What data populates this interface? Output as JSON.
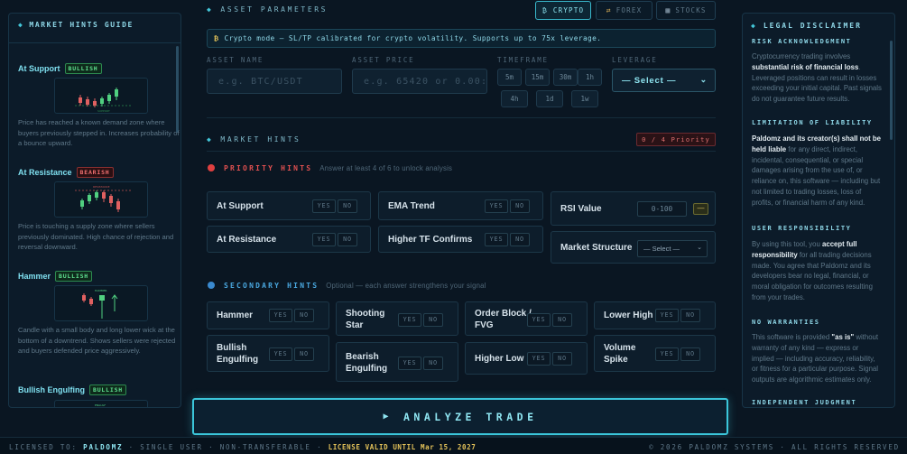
{
  "left": {
    "title": "MARKET HINTS GUIDE",
    "items": [
      {
        "title": "At Support",
        "badge": "BULLISH",
        "desc": "Price has reached a known demand zone where buyers previously stepped in. Increases probability of a bounce upward."
      },
      {
        "title": "At Resistance",
        "badge": "BEARISH",
        "desc": "Price is touching a supply zone where sellers previously dominated. High chance of rejection and reversal downward."
      },
      {
        "title": "Hammer",
        "badge": "BULLISH",
        "desc": "Candle with a small body and long lower wick at the bottom of a downtrend. Shows sellers were rejected and buyers defended price aggressively."
      },
      {
        "title": "Bullish Engulfing",
        "badge": "BULLISH",
        "desc": ""
      }
    ]
  },
  "asset": {
    "title": "ASSET PARAMETERS",
    "tabs": {
      "crypto": "₿ CRYPTO",
      "forex": "FOREX",
      "stocks": "STOCKS"
    },
    "info": "Crypto mode — SL/TP calibrated for crypto volatility. Supports up to 75x leverage.",
    "info_icon": "₿",
    "name_label": "ASSET NAME",
    "name_placeholder": "e.g. BTC/USDT",
    "price_label": "ASSET PRICE",
    "price_placeholder": "e.g. 65420 or 0.00:",
    "timeframe_label": "TIMEFRAME",
    "timeframes": [
      "5m",
      "15m",
      "30m",
      "1h",
      "4h",
      "1d",
      "1w"
    ],
    "leverage_label": "LEVERAGE",
    "leverage_value": "— Select —"
  },
  "hints": {
    "title": "MARKET HINTS",
    "priority_count": "0 / 4 Priority",
    "priority_title": "PRIORITY HINTS",
    "priority_sub": "Answer at least 4 of 6 to unlock analysis",
    "priority_cards": [
      {
        "label": "At Support"
      },
      {
        "label": "EMA Trend"
      },
      {
        "label": "At Resistance"
      },
      {
        "label": "Higher TF Confirms"
      }
    ],
    "rsi_label": "RSI Value",
    "rsi_placeholder": "0-100",
    "rsi_dash": "—",
    "ms_label": "Market Structure",
    "ms_value": "— Select —",
    "secondary_title": "SECONDARY HINTS",
    "secondary_sub": "Optional — each answer strengthens your signal",
    "secondary_cards": [
      {
        "label": "Hammer"
      },
      {
        "label": "Shooting Star"
      },
      {
        "label": "Order Block / FVG"
      },
      {
        "label": "Lower High"
      },
      {
        "label": "Bullish Engulfing"
      },
      {
        "label": "Bearish Engulfing"
      },
      {
        "label": "Higher Low"
      },
      {
        "label": "Volume Spike"
      }
    ],
    "yes": "YES",
    "no": "NO"
  },
  "analyze_label": "ANALYZE TRADE",
  "right": {
    "title": "LEGAL DISCLAIMER",
    "s1_title": "RISK ACKNOWLEDGMENT",
    "s1_a": "Cryptocurrency trading involves ",
    "s1_b": "substantial risk of financial loss",
    "s1_c": ". Leveraged positions can result in losses exceeding your initial capital. Past signals do not guarantee future results.",
    "s2_title": "LIMITATION OF LIABILITY",
    "s2_b": "Paldomz and its creator(s) shall not be held liable",
    "s2_c": " for any direct, indirect, incidental, consequential, or special damages arising from the use of, or reliance on, this software — including but not limited to trading losses, loss of profits, or financial harm of any kind.",
    "s3_title": "USER RESPONSIBILITY",
    "s3_a": "By using this tool, you ",
    "s3_b": "accept full responsibility",
    "s3_c": " for all trading decisions made. You agree that Paldomz and its developers bear no legal, financial, or moral obligation for outcomes resulting from your trades.",
    "s4_title": "NO WARRANTIES",
    "s4_a": "This software is provided ",
    "s4_b": "\"as is\"",
    "s4_c": " without warranty of any kind — express or implied — including accuracy, reliability, or fitness for a particular purpose. Signal outputs are algorithmic estimates only.",
    "s5_title": "INDEPENDENT JUDGMENT"
  },
  "footer": {
    "licensed_to": "LICENSED TO:",
    "name": "PALDOMZ",
    "rest": " · SINGLE USER · NON-TRANSFERABLE · ",
    "valid": "LICENSE VALID UNTIL Mar 15, 2027",
    "right": "© 2026 PALDOMZ SYSTEMS · ALL RIGHTS RESERVED"
  }
}
